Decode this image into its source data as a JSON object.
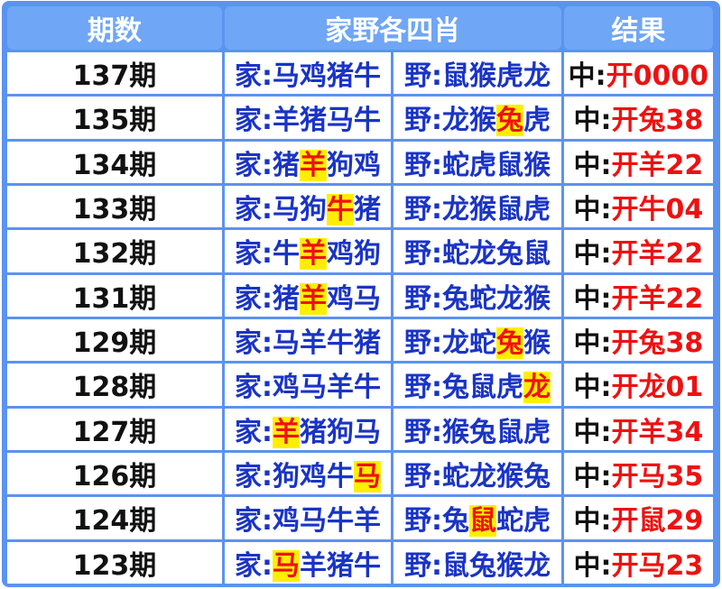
{
  "header": {
    "period": "期数",
    "combo": "家野各四肖",
    "result": "结果"
  },
  "rows": [
    {
      "period": "137期",
      "home": {
        "prefix": "家:",
        "animals": [
          "马",
          "鸡",
          "猪",
          "牛"
        ],
        "hl": -1
      },
      "wild": {
        "prefix": "野:",
        "animals": [
          "鼠",
          "猴",
          "虎",
          "龙"
        ],
        "hl": -1
      },
      "result": {
        "prefix": "中:",
        "value": "开0000"
      }
    },
    {
      "period": "135期",
      "home": {
        "prefix": "家:",
        "animals": [
          "羊",
          "猪",
          "马",
          "牛"
        ],
        "hl": -1
      },
      "wild": {
        "prefix": "野:",
        "animals": [
          "龙",
          "猴",
          "兔",
          "虎"
        ],
        "hl": 2
      },
      "result": {
        "prefix": "中:",
        "value": "开兔38"
      }
    },
    {
      "period": "134期",
      "home": {
        "prefix": "家:",
        "animals": [
          "猪",
          "羊",
          "狗",
          "鸡"
        ],
        "hl": 1
      },
      "wild": {
        "prefix": "野:",
        "animals": [
          "蛇",
          "虎",
          "鼠",
          "猴"
        ],
        "hl": -1
      },
      "result": {
        "prefix": "中:",
        "value": "开羊22"
      }
    },
    {
      "period": "133期",
      "home": {
        "prefix": "家:",
        "animals": [
          "马",
          "狗",
          "牛",
          "猪"
        ],
        "hl": 2
      },
      "wild": {
        "prefix": "野:",
        "animals": [
          "龙",
          "猴",
          "鼠",
          "虎"
        ],
        "hl": -1
      },
      "result": {
        "prefix": "中:",
        "value": "开牛04"
      }
    },
    {
      "period": "132期",
      "home": {
        "prefix": "家:",
        "animals": [
          "牛",
          "羊",
          "鸡",
          "狗"
        ],
        "hl": 1
      },
      "wild": {
        "prefix": "野:",
        "animals": [
          "蛇",
          "龙",
          "兔",
          "鼠"
        ],
        "hl": -1
      },
      "result": {
        "prefix": "中:",
        "value": "开羊22"
      }
    },
    {
      "period": "131期",
      "home": {
        "prefix": "家:",
        "animals": [
          "猪",
          "羊",
          "鸡",
          "马"
        ],
        "hl": 1
      },
      "wild": {
        "prefix": "野:",
        "animals": [
          "兔",
          "蛇",
          "龙",
          "猴"
        ],
        "hl": -1
      },
      "result": {
        "prefix": "中:",
        "value": "开羊22"
      }
    },
    {
      "period": "129期",
      "home": {
        "prefix": "家:",
        "animals": [
          "马",
          "羊",
          "牛",
          "猪"
        ],
        "hl": -1
      },
      "wild": {
        "prefix": "野:",
        "animals": [
          "龙",
          "蛇",
          "兔",
          "猴"
        ],
        "hl": 2
      },
      "result": {
        "prefix": "中:",
        "value": "开兔38"
      }
    },
    {
      "period": "128期",
      "home": {
        "prefix": "家:",
        "animals": [
          "鸡",
          "马",
          "羊",
          "牛"
        ],
        "hl": -1
      },
      "wild": {
        "prefix": "野:",
        "animals": [
          "兔",
          "鼠",
          "虎",
          "龙"
        ],
        "hl": 3
      },
      "result": {
        "prefix": "中:",
        "value": "开龙01"
      }
    },
    {
      "period": "127期",
      "home": {
        "prefix": "家:",
        "animals": [
          "羊",
          "猪",
          "狗",
          "马"
        ],
        "hl": 0
      },
      "wild": {
        "prefix": "野:",
        "animals": [
          "猴",
          "兔",
          "鼠",
          "虎"
        ],
        "hl": -1
      },
      "result": {
        "prefix": "中:",
        "value": "开羊34"
      }
    },
    {
      "period": "126期",
      "home": {
        "prefix": "家:",
        "animals": [
          "狗",
          "鸡",
          "牛",
          "马"
        ],
        "hl": 3
      },
      "wild": {
        "prefix": "野:",
        "animals": [
          "蛇",
          "龙",
          "猴",
          "兔"
        ],
        "hl": -1
      },
      "result": {
        "prefix": "中:",
        "value": "开马35"
      }
    },
    {
      "period": "124期",
      "home": {
        "prefix": "家:",
        "animals": [
          "鸡",
          "马",
          "牛",
          "羊"
        ],
        "hl": -1
      },
      "wild": {
        "prefix": "野:",
        "animals": [
          "兔",
          "鼠",
          "蛇",
          "虎"
        ],
        "hl": 1
      },
      "result": {
        "prefix": "中:",
        "value": "开鼠29"
      }
    },
    {
      "period": "123期",
      "home": {
        "prefix": "家:",
        "animals": [
          "马",
          "羊",
          "猪",
          "牛"
        ],
        "hl": 0
      },
      "wild": {
        "prefix": "野:",
        "animals": [
          "鼠",
          "兔",
          "猴",
          "龙"
        ],
        "hl": -1
      },
      "result": {
        "prefix": "中:",
        "value": "开马23"
      }
    }
  ],
  "colors": {
    "frame": "#5b93f0",
    "header": "#6fa6f6",
    "zodiac_text": "#1a34c6",
    "result_value": "#ee1111",
    "highlight": "#ffee00"
  }
}
